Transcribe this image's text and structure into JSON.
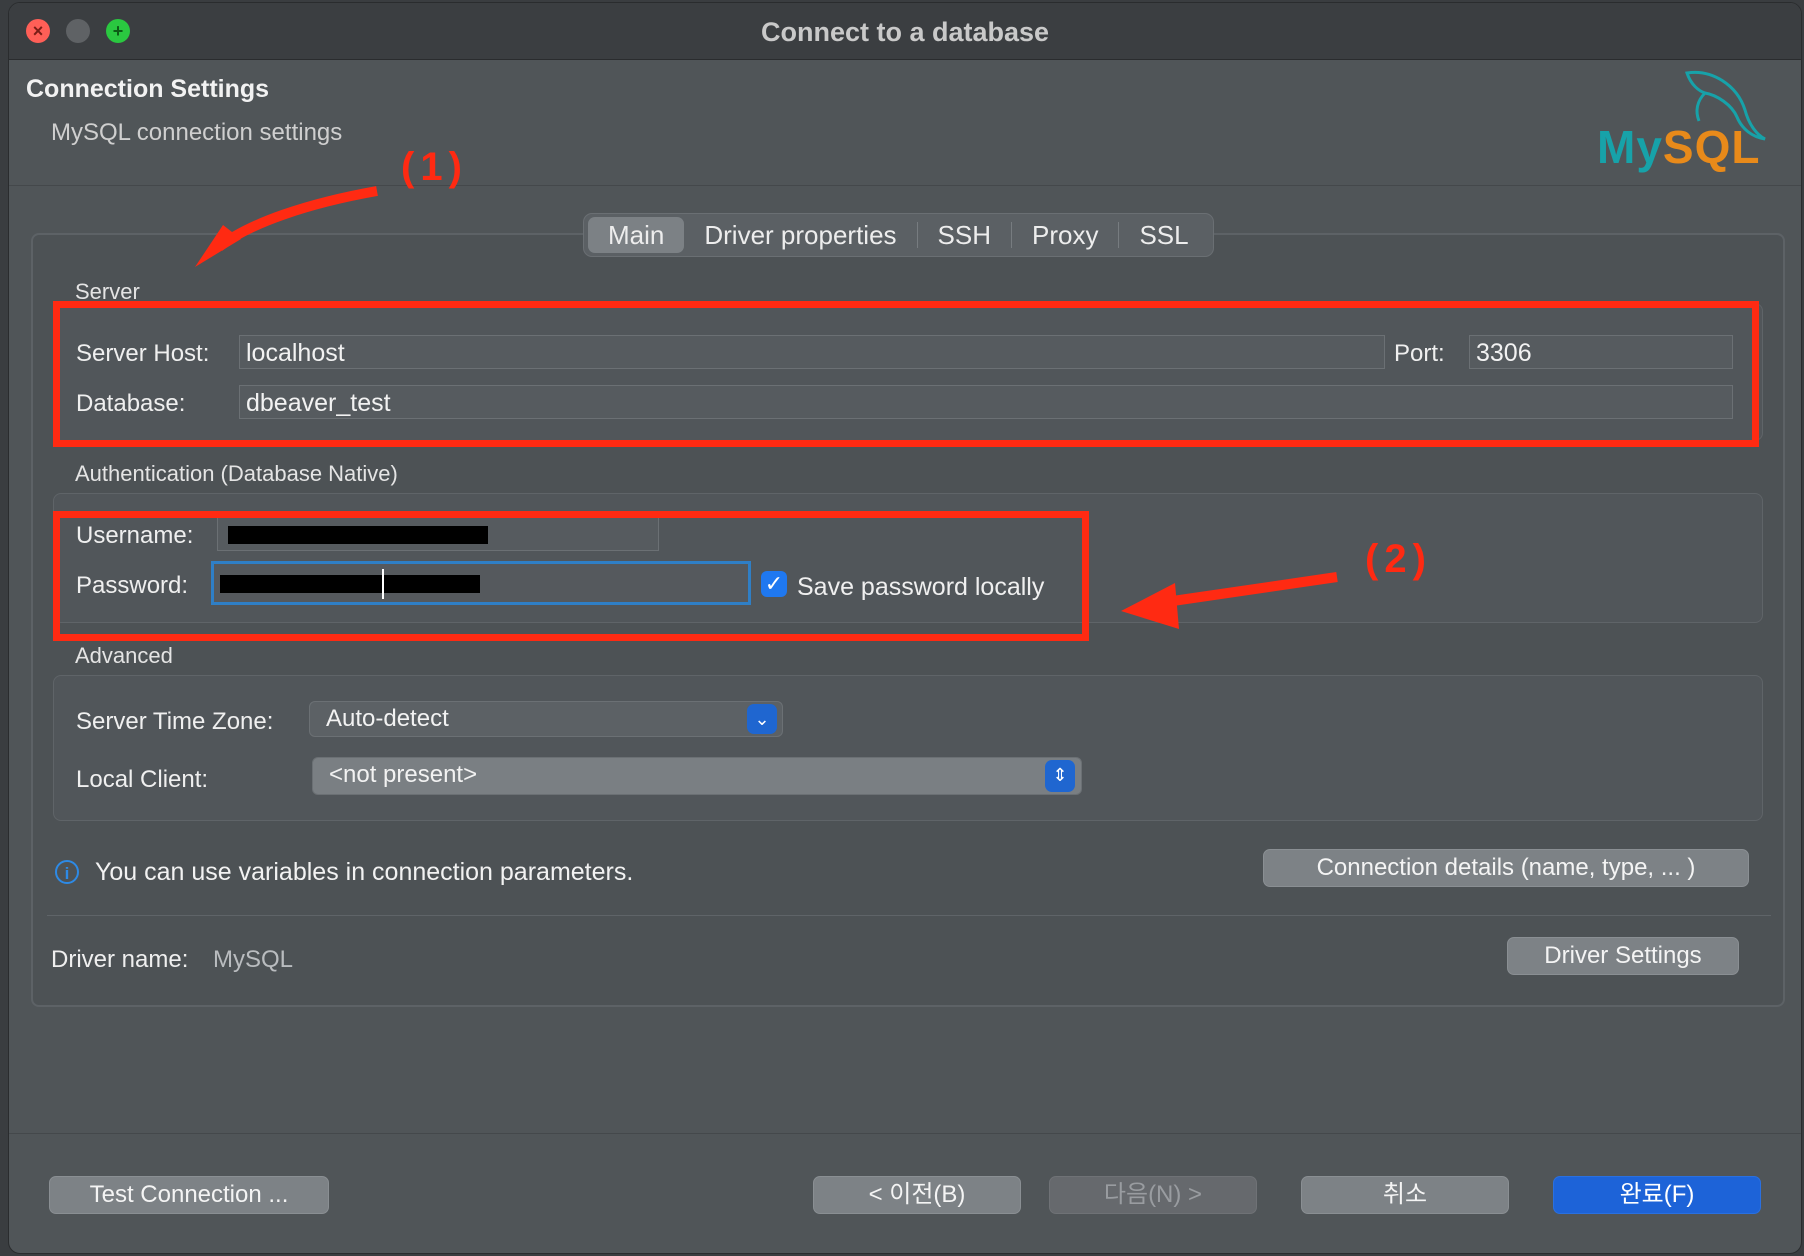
{
  "window": {
    "title": "Connect to a database"
  },
  "header": {
    "title": "Connection Settings",
    "subtitle": "MySQL connection settings",
    "logo_text_my": "My",
    "logo_text_sql": "SQL"
  },
  "tabs": [
    {
      "label": "Main",
      "active": true
    },
    {
      "label": "Driver properties",
      "active": false
    },
    {
      "label": "SSH",
      "active": false
    },
    {
      "label": "Proxy",
      "active": false
    },
    {
      "label": "SSL",
      "active": false
    }
  ],
  "server": {
    "group_label": "Server",
    "host_label": "Server Host:",
    "host_value": "localhost",
    "port_label": "Port:",
    "port_value": "3306",
    "database_label": "Database:",
    "database_value": "dbeaver_test"
  },
  "auth": {
    "group_label": "Authentication (Database Native)",
    "username_label": "Username:",
    "password_label": "Password:",
    "save_password_label": "Save password locally",
    "save_password_checked": true
  },
  "advanced": {
    "group_label": "Advanced",
    "timezone_label": "Server Time Zone:",
    "timezone_value": "Auto-detect",
    "local_client_label": "Local Client:",
    "local_client_value": "<not present>"
  },
  "info": {
    "text": "You can use variables in connection parameters.",
    "connection_details_button": "Connection details (name, type, ... )"
  },
  "driver": {
    "label": "Driver name:",
    "value": "MySQL",
    "settings_button": "Driver Settings"
  },
  "footer": {
    "test_connection": "Test Connection ...",
    "back": "< 이전(B)",
    "next": "다음(N) >",
    "cancel": "취소",
    "finish": "완료(F)"
  },
  "annotations": {
    "label_1": "(1)",
    "label_2": "(2)",
    "color": "#ff2a12"
  },
  "colors": {
    "accent": "#1d63d8",
    "window_bg": "#505558",
    "annotation": "#ff2a12"
  }
}
